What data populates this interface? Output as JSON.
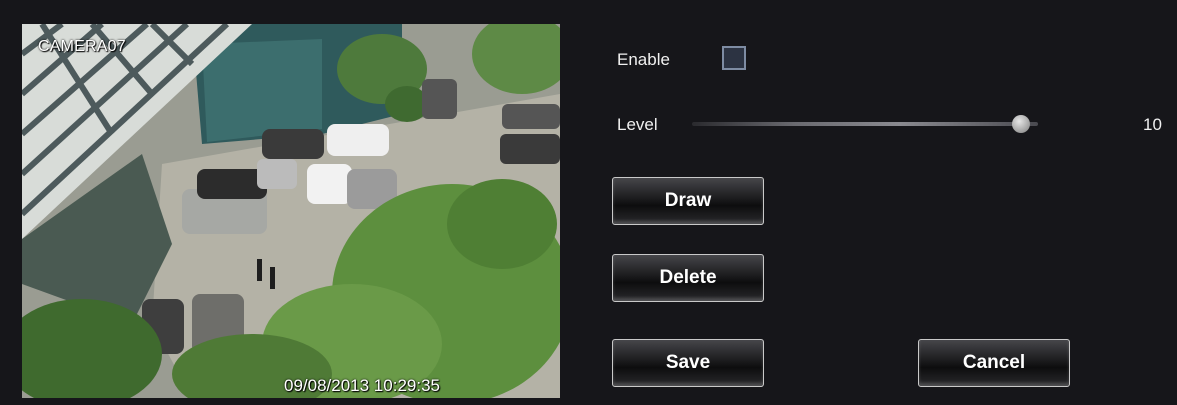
{
  "camera": {
    "name": "CAMERA07",
    "timestamp": "09/08/2013 10:29:35"
  },
  "settings": {
    "enable_label": "Enable",
    "enable_checked": false,
    "level_label": "Level",
    "level_value": "10",
    "level_fraction": 0.95
  },
  "buttons": {
    "draw": "Draw",
    "delete": "Delete",
    "save": "Save",
    "cancel": "Cancel"
  },
  "colors": {
    "background": "#16161a",
    "checkbox_border": "#7e8ca3"
  }
}
